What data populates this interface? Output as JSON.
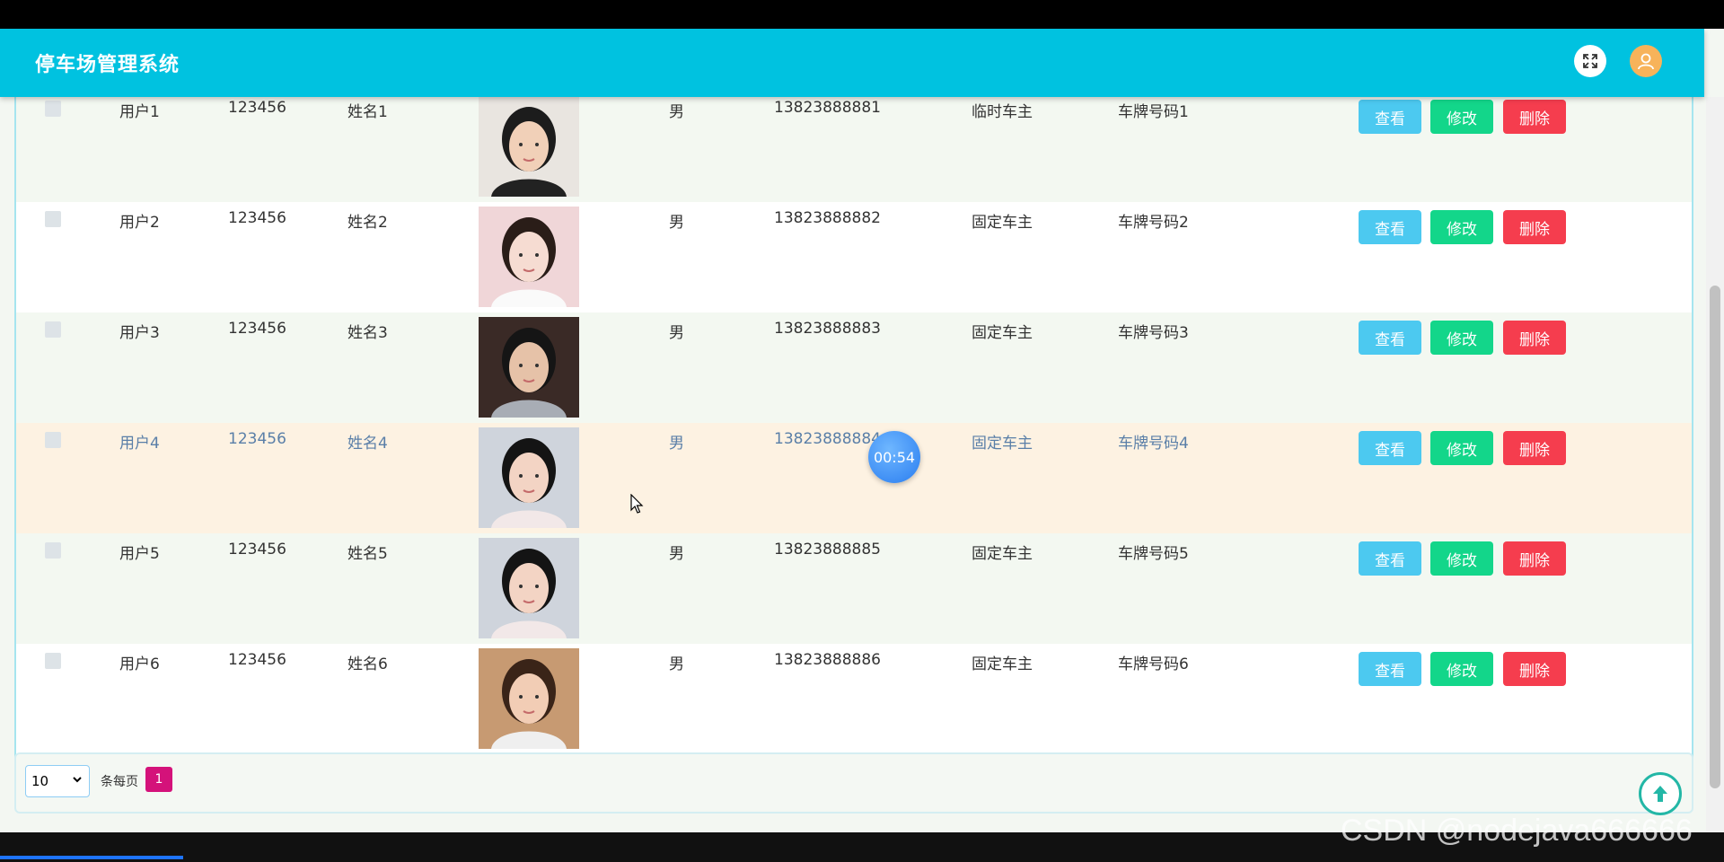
{
  "app": {
    "title": "停车场管理系统"
  },
  "header": {
    "fullscreen_icon": "fullscreen-icon",
    "user_icon": "user-icon",
    "color": "#00c2e0"
  },
  "table": {
    "rows": [
      {
        "username": "用户1",
        "password": "123456",
        "name": "姓名1",
        "gender": "男",
        "phone": "13823888881",
        "type": "临时车主",
        "plate": "车牌号码1"
      },
      {
        "username": "用户2",
        "password": "123456",
        "name": "姓名2",
        "gender": "男",
        "phone": "13823888882",
        "type": "固定车主",
        "plate": "车牌号码2"
      },
      {
        "username": "用户3",
        "password": "123456",
        "name": "姓名3",
        "gender": "男",
        "phone": "13823888883",
        "type": "固定车主",
        "plate": "车牌号码3"
      },
      {
        "username": "用户4",
        "password": "123456",
        "name": "姓名4",
        "gender": "男",
        "phone": "13823888884",
        "type": "固定车主",
        "plate": "车牌号码4"
      },
      {
        "username": "用户5",
        "password": "123456",
        "name": "姓名5",
        "gender": "男",
        "phone": "13823888885",
        "type": "固定车主",
        "plate": "车牌号码5"
      },
      {
        "username": "用户6",
        "password": "123456",
        "name": "姓名6",
        "gender": "男",
        "phone": "13823888886",
        "type": "固定车主",
        "plate": "车牌号码6"
      }
    ],
    "actions": {
      "view": "查看",
      "edit": "修改",
      "delete": "删除"
    }
  },
  "pagination": {
    "page_size": "10",
    "per_page_label": "条每页",
    "current_page": "1"
  },
  "overlay": {
    "timer": "00:54",
    "watermark": "CSDN @nodejava666666"
  }
}
